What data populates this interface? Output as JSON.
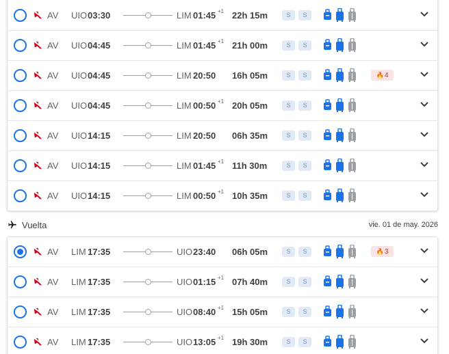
{
  "ida": {
    "rows": [
      {
        "selected": false,
        "airline": "AV",
        "dep_code": "UIO",
        "dep_time": "03:30",
        "arr_code": "LIM",
        "arr_time": "01:45",
        "day_offset": "+1",
        "duration": "22h 15m",
        "badge1": "S",
        "badge2": "S",
        "seats": ""
      },
      {
        "selected": false,
        "airline": "AV",
        "dep_code": "UIO",
        "dep_time": "04:45",
        "arr_code": "LIM",
        "arr_time": "01:45",
        "day_offset": "+1",
        "duration": "21h 00m",
        "badge1": "S",
        "badge2": "S",
        "seats": ""
      },
      {
        "selected": false,
        "airline": "AV",
        "dep_code": "UIO",
        "dep_time": "04:45",
        "arr_code": "LIM",
        "arr_time": "20:50",
        "day_offset": "",
        "duration": "16h 05m",
        "badge1": "S",
        "badge2": "S",
        "seats": "4"
      },
      {
        "selected": false,
        "airline": "AV",
        "dep_code": "UIO",
        "dep_time": "04:45",
        "arr_code": "LIM",
        "arr_time": "00:50",
        "day_offset": "+1",
        "duration": "20h 05m",
        "badge1": "S",
        "badge2": "S",
        "seats": ""
      },
      {
        "selected": false,
        "airline": "AV",
        "dep_code": "UIO",
        "dep_time": "14:15",
        "arr_code": "LIM",
        "arr_time": "20:50",
        "day_offset": "",
        "duration": "06h 35m",
        "badge1": "S",
        "badge2": "S",
        "seats": ""
      },
      {
        "selected": false,
        "airline": "AV",
        "dep_code": "UIO",
        "dep_time": "14:15",
        "arr_code": "LIM",
        "arr_time": "01:45",
        "day_offset": "+1",
        "duration": "11h 30m",
        "badge1": "S",
        "badge2": "S",
        "seats": ""
      },
      {
        "selected": false,
        "airline": "AV",
        "dep_code": "UIO",
        "dep_time": "14:15",
        "arr_code": "LIM",
        "arr_time": "00:50",
        "day_offset": "+1",
        "duration": "10h 35m",
        "badge1": "S",
        "badge2": "S",
        "seats": ""
      }
    ]
  },
  "vuelta": {
    "title": "Vuelta",
    "date": "vie. 01 de may. 2026",
    "plane_icon": "airplane-icon",
    "rows": [
      {
        "selected": true,
        "airline": "AV",
        "dep_code": "LIM",
        "dep_time": "17:35",
        "arr_code": "UIO",
        "arr_time": "23:40",
        "day_offset": "",
        "duration": "06h 05m",
        "badge1": "S",
        "badge2": "S",
        "seats": "3"
      },
      {
        "selected": false,
        "airline": "AV",
        "dep_code": "LIM",
        "dep_time": "17:35",
        "arr_code": "UIO",
        "arr_time": "01:15",
        "day_offset": "+1",
        "duration": "07h 40m",
        "badge1": "S",
        "badge2": "S",
        "seats": ""
      },
      {
        "selected": false,
        "airline": "AV",
        "dep_code": "LIM",
        "dep_time": "17:35",
        "arr_code": "UIO",
        "arr_time": "08:40",
        "day_offset": "+1",
        "duration": "15h 05m",
        "badge1": "S",
        "badge2": "S",
        "seats": ""
      },
      {
        "selected": false,
        "airline": "AV",
        "dep_code": "LIM",
        "dep_time": "17:35",
        "arr_code": "UIO",
        "arr_time": "13:05",
        "day_offset": "+1",
        "duration": "19h 30m",
        "badge1": "S",
        "badge2": "S",
        "seats": ""
      }
    ]
  },
  "icons": {
    "airline_logo": "airline-logo-icon",
    "personal_item": "personal-item-icon",
    "carry_on": "carry-on-bag-icon",
    "checked_bag": "checked-bag-icon",
    "seats_flame": "flame-icon",
    "expand": "chevron-down-icon"
  },
  "colors": {
    "accent": "#1a73e8",
    "airline_red": "#d0021b",
    "included_bag": "#1a73e8",
    "not_included_bag": "#9aa0a6",
    "seat_badge_bg": "#fbe4e4",
    "seat_badge_text": "#d93025",
    "fare_badge_bg": "#e2eaf6"
  }
}
